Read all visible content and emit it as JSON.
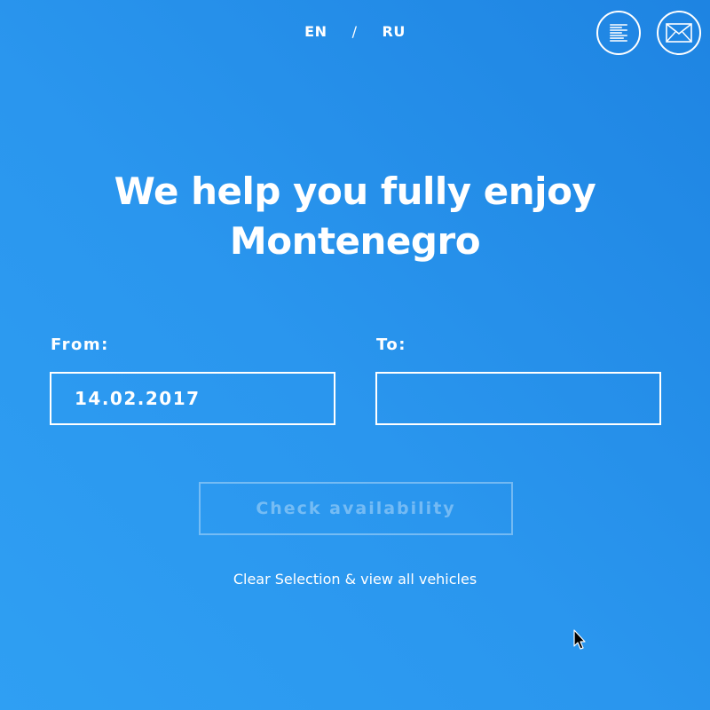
{
  "language": {
    "options": [
      "EN",
      "RU"
    ],
    "separator": "/"
  },
  "header_icons": {
    "menu": "menu-lines-icon",
    "mail": "envelope-icon"
  },
  "hero": {
    "line1": "We help you fully enjoy",
    "line2": "Montenegro"
  },
  "form": {
    "from_label": "From:",
    "from_value": "14.02.2017",
    "to_label": "To:",
    "to_value": "",
    "submit_label": "Check availability"
  },
  "clear_link": "Clear Selection & view all vehicles",
  "colors": {
    "background_start": "#1e84e2",
    "background_end": "#2f9ff3",
    "foreground": "#ffffff"
  }
}
